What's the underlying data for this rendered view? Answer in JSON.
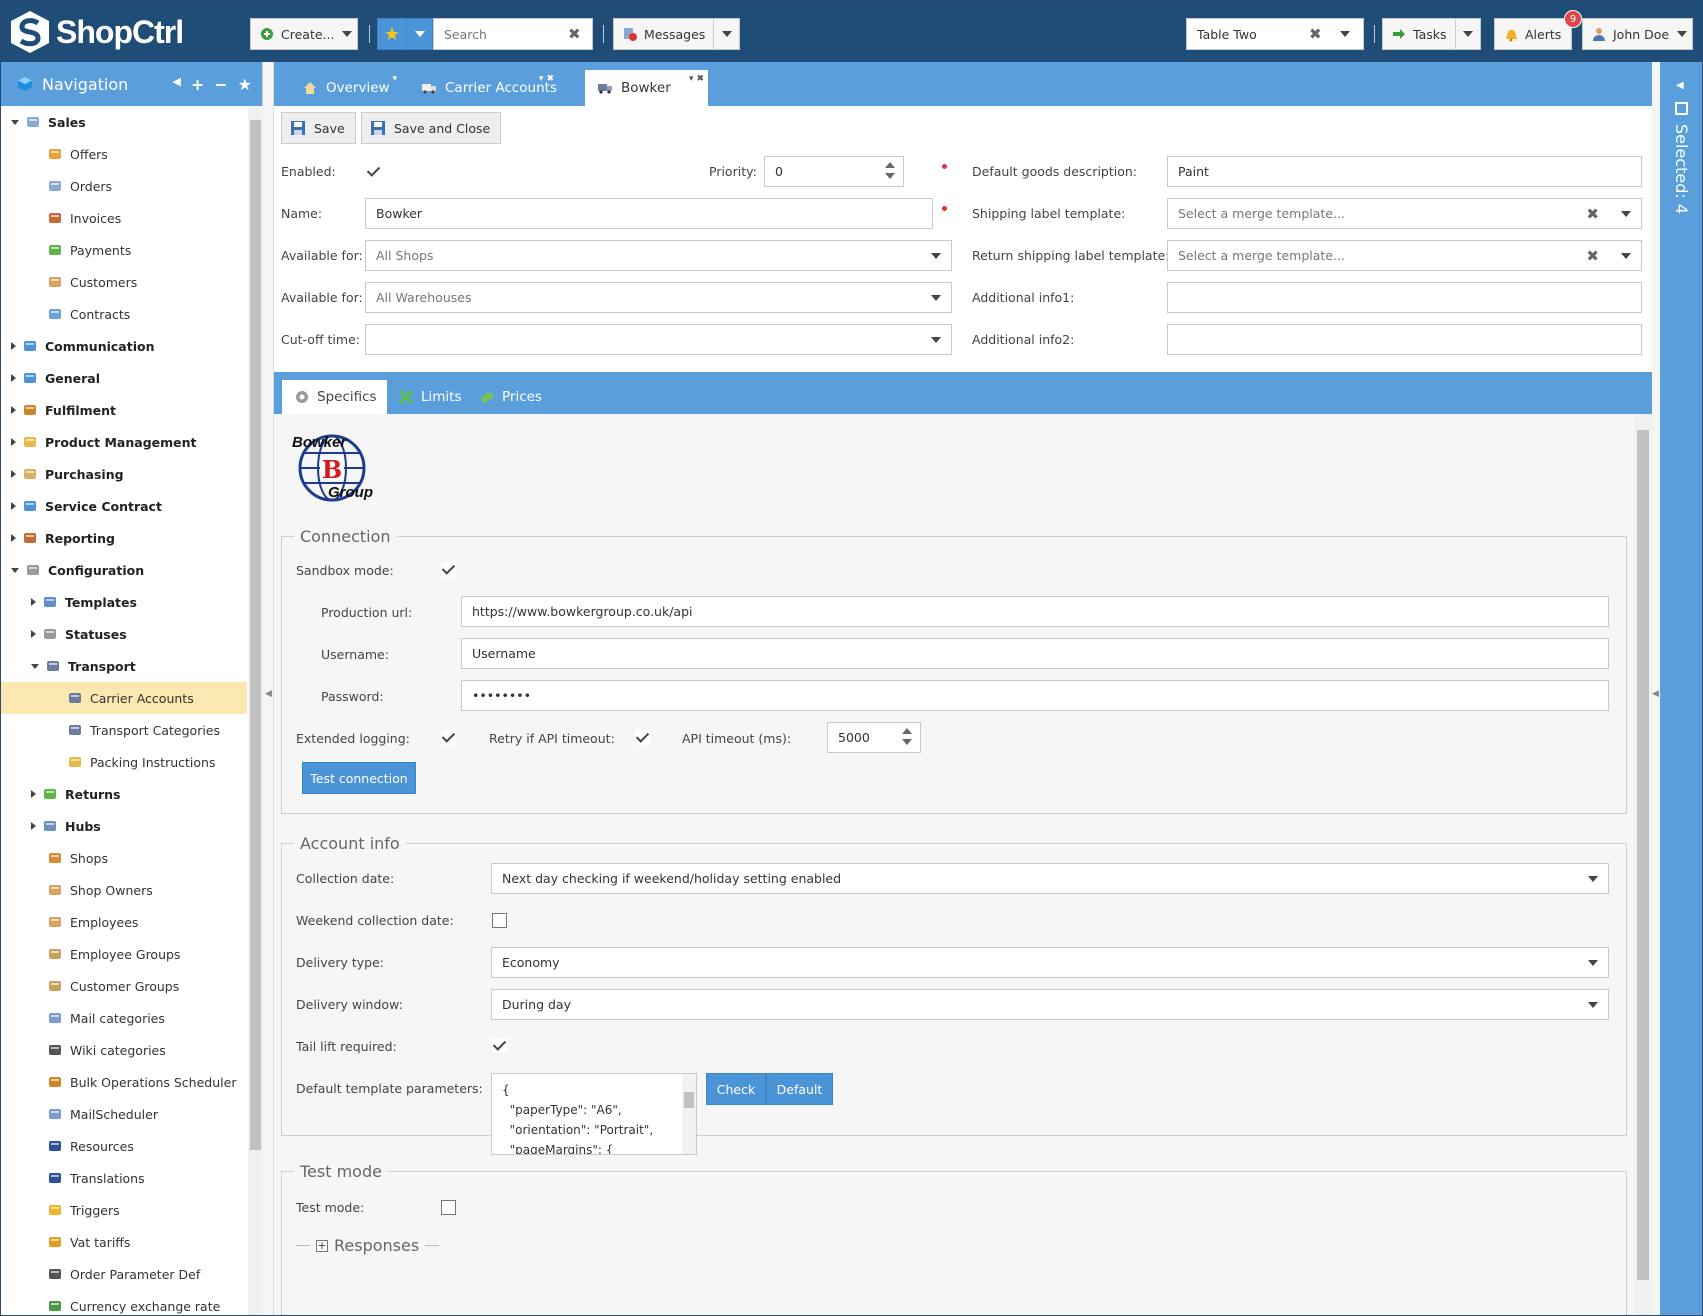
{
  "app": {
    "logo_text": "ShopCtrl",
    "brand_color": "#1f4d78",
    "accent_color": "#5a9fdc"
  },
  "topbar": {
    "create_label": "Create...",
    "search_placeholder": "Search",
    "messages_label": "Messages",
    "table_select": "Table Two",
    "tasks_label": "Tasks",
    "alerts_label": "Alerts",
    "alerts_count": "9",
    "user_label": "John Doe"
  },
  "navigation": {
    "title": "Navigation",
    "items": [
      {
        "label": "Sales",
        "icon": "basket-icon",
        "level": 0,
        "bold": true,
        "toggle": "open"
      },
      {
        "label": "Offers",
        "icon": "offer-icon",
        "level": 1
      },
      {
        "label": "Orders",
        "icon": "orders-icon",
        "level": 1
      },
      {
        "label": "Invoices",
        "icon": "invoice-icon",
        "level": 1
      },
      {
        "label": "Payments",
        "icon": "payment-icon",
        "level": 1
      },
      {
        "label": "Customers",
        "icon": "customers-icon",
        "level": 1
      },
      {
        "label": "Contracts",
        "icon": "contract-icon",
        "level": 1
      },
      {
        "label": "Communication",
        "icon": "chat-icon",
        "level": 0,
        "bold": true,
        "toggle": "closed"
      },
      {
        "label": "General",
        "icon": "dot-icon",
        "level": 0,
        "bold": true,
        "toggle": "closed"
      },
      {
        "label": "Fulfilment",
        "icon": "box-icon",
        "level": 0,
        "bold": true,
        "toggle": "closed"
      },
      {
        "label": "Product Management",
        "icon": "package-icon",
        "level": 0,
        "bold": true,
        "toggle": "closed"
      },
      {
        "label": "Purchasing",
        "icon": "purchase-icon",
        "level": 0,
        "bold": true,
        "toggle": "closed"
      },
      {
        "label": "Service Contract",
        "icon": "service-icon",
        "level": 0,
        "bold": true,
        "toggle": "closed"
      },
      {
        "label": "Reporting",
        "icon": "report-icon",
        "level": 0,
        "bold": true,
        "toggle": "closed"
      },
      {
        "label": "Configuration",
        "icon": "gear-icon",
        "level": 0,
        "bold": true,
        "toggle": "open"
      },
      {
        "label": "Templates",
        "icon": "template-icon",
        "level": 1,
        "bold": true,
        "toggle": "closed"
      },
      {
        "label": "Statuses",
        "icon": "gear-icon",
        "level": 1,
        "bold": true,
        "toggle": "closed"
      },
      {
        "label": "Transport",
        "icon": "truck-icon",
        "level": 1,
        "bold": true,
        "toggle": "open"
      },
      {
        "label": "Carrier Accounts",
        "icon": "truck-icon",
        "level": 2,
        "selected": true
      },
      {
        "label": "Transport Categories",
        "icon": "truck-icon",
        "level": 2
      },
      {
        "label": "Packing Instructions",
        "icon": "package-icon",
        "level": 2
      },
      {
        "label": "Returns",
        "icon": "return-icon",
        "level": 1,
        "bold": true,
        "toggle": "closed"
      },
      {
        "label": "Hubs",
        "icon": "hub-icon",
        "level": 1,
        "bold": true,
        "toggle": "closed"
      },
      {
        "label": "Shops",
        "icon": "shop-icon",
        "level": 1
      },
      {
        "label": "Shop Owners",
        "icon": "user-icon",
        "level": 1
      },
      {
        "label": "Employees",
        "icon": "user-icon",
        "level": 1
      },
      {
        "label": "Employee Groups",
        "icon": "users-icon",
        "level": 1
      },
      {
        "label": "Customer Groups",
        "icon": "users-icon",
        "level": 1
      },
      {
        "label": "Mail categories",
        "icon": "mail-icon",
        "level": 1
      },
      {
        "label": "Wiki categories",
        "icon": "anchor-icon",
        "level": 1
      },
      {
        "label": "Bulk Operations Scheduler",
        "icon": "box-icon",
        "level": 1
      },
      {
        "label": "MailScheduler",
        "icon": "mail-icon",
        "level": 1
      },
      {
        "label": "Resources",
        "icon": "flag-icon",
        "level": 1
      },
      {
        "label": "Translations",
        "icon": "flag-icon",
        "level": 1
      },
      {
        "label": "Triggers",
        "icon": "lightning-icon",
        "level": 1
      },
      {
        "label": "Vat tariffs",
        "icon": "euro-icon",
        "level": 1
      },
      {
        "label": "Order Parameter Def",
        "icon": "list-icon",
        "level": 1
      },
      {
        "label": "Currency exchange rate",
        "icon": "dollar-icon",
        "level": 1
      }
    ]
  },
  "tabs": [
    {
      "label": "Overview",
      "icon": "home-icon"
    },
    {
      "label": "Carrier Accounts",
      "icon": "truck-icon"
    },
    {
      "label": "Bowker",
      "icon": "truck-icon",
      "active": true
    }
  ],
  "selected_panel": "Selected: 4",
  "toolbar": {
    "save": "Save",
    "save_close": "Save and Close"
  },
  "form": {
    "enabled_label": "Enabled:",
    "enabled": true,
    "priority_label": "Priority:",
    "priority": "0",
    "name_label": "Name:",
    "name": "Bowker",
    "available_shops_label": "Available for:",
    "available_shops": "All Shops",
    "available_wh_label": "Available for:",
    "available_wh": "All Warehouses",
    "cutoff_label": "Cut-off time:",
    "cutoff": "",
    "goods_desc_label": "Default goods description:",
    "goods_desc": "Paint",
    "ship_tpl_label": "Shipping label template:",
    "ship_tpl_placeholder": "Select a merge template...",
    "ret_tpl_label": "Return shipping label template:",
    "ret_tpl_placeholder": "Select a merge template...",
    "info1_label": "Additional info1:",
    "info1": "",
    "info2_label": "Additional info2:",
    "info2": ""
  },
  "subtabs": [
    {
      "label": "Specifics",
      "icon": "gear-icon",
      "active": true
    },
    {
      "label": "Limits",
      "icon": "limits-icon"
    },
    {
      "label": "Prices",
      "icon": "price-icon"
    }
  ],
  "carrier_logo": {
    "top": "Bowker",
    "letter": "B",
    "bottom": "Group"
  },
  "connection": {
    "legend": "Connection",
    "sandbox_label": "Sandbox mode:",
    "sandbox": true,
    "prod_url_label": "Production url:",
    "prod_url": "https://www.bowkergroup.co.uk/api",
    "username_label": "Username:",
    "username": "Username",
    "password_label": "Password:",
    "password": "••••••••",
    "ext_log_label": "Extended logging:",
    "ext_log": true,
    "retry_label": "Retry if API timeout:",
    "retry": true,
    "timeout_label": "API timeout (ms):",
    "timeout": "5000",
    "test_button": "Test connection"
  },
  "account": {
    "legend": "Account info",
    "collection_label": "Collection date:",
    "collection": "Next day checking if weekend/holiday setting enabled",
    "weekend_label": "Weekend collection date:",
    "weekend": false,
    "delivery_type_label": "Delivery type:",
    "delivery_type": "Economy",
    "delivery_window_label": "Delivery window:",
    "delivery_window": "During day",
    "tail_lift_label": "Tail lift required:",
    "tail_lift": true,
    "params_label": "Default template parameters:",
    "params_text": "{\n  \"paperType\": \"A6\",\n  \"orientation\": \"Portrait\",\n  \"pageMargins\": {",
    "check_button": "Check",
    "default_button": "Default"
  },
  "testmode": {
    "legend": "Test mode",
    "label": "Test mode:",
    "enabled": false,
    "responses_legend": "Responses"
  }
}
